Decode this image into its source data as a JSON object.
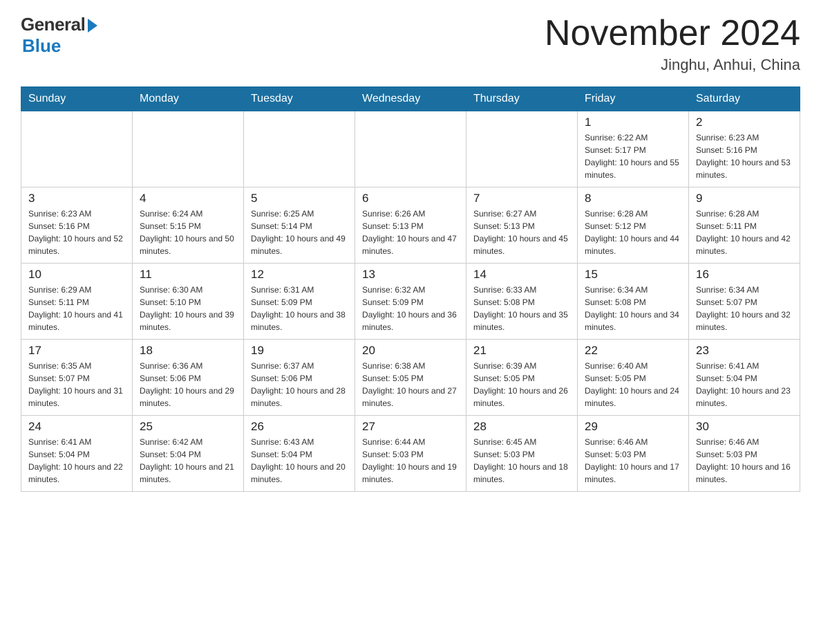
{
  "header": {
    "logo_general": "General",
    "logo_blue": "Blue",
    "month_title": "November 2024",
    "location": "Jinghu, Anhui, China"
  },
  "weekdays": [
    "Sunday",
    "Monday",
    "Tuesday",
    "Wednesday",
    "Thursday",
    "Friday",
    "Saturday"
  ],
  "weeks": [
    [
      {
        "day": "",
        "info": ""
      },
      {
        "day": "",
        "info": ""
      },
      {
        "day": "",
        "info": ""
      },
      {
        "day": "",
        "info": ""
      },
      {
        "day": "",
        "info": ""
      },
      {
        "day": "1",
        "info": "Sunrise: 6:22 AM\nSunset: 5:17 PM\nDaylight: 10 hours and 55 minutes."
      },
      {
        "day": "2",
        "info": "Sunrise: 6:23 AM\nSunset: 5:16 PM\nDaylight: 10 hours and 53 minutes."
      }
    ],
    [
      {
        "day": "3",
        "info": "Sunrise: 6:23 AM\nSunset: 5:16 PM\nDaylight: 10 hours and 52 minutes."
      },
      {
        "day": "4",
        "info": "Sunrise: 6:24 AM\nSunset: 5:15 PM\nDaylight: 10 hours and 50 minutes."
      },
      {
        "day": "5",
        "info": "Sunrise: 6:25 AM\nSunset: 5:14 PM\nDaylight: 10 hours and 49 minutes."
      },
      {
        "day": "6",
        "info": "Sunrise: 6:26 AM\nSunset: 5:13 PM\nDaylight: 10 hours and 47 minutes."
      },
      {
        "day": "7",
        "info": "Sunrise: 6:27 AM\nSunset: 5:13 PM\nDaylight: 10 hours and 45 minutes."
      },
      {
        "day": "8",
        "info": "Sunrise: 6:28 AM\nSunset: 5:12 PM\nDaylight: 10 hours and 44 minutes."
      },
      {
        "day": "9",
        "info": "Sunrise: 6:28 AM\nSunset: 5:11 PM\nDaylight: 10 hours and 42 minutes."
      }
    ],
    [
      {
        "day": "10",
        "info": "Sunrise: 6:29 AM\nSunset: 5:11 PM\nDaylight: 10 hours and 41 minutes."
      },
      {
        "day": "11",
        "info": "Sunrise: 6:30 AM\nSunset: 5:10 PM\nDaylight: 10 hours and 39 minutes."
      },
      {
        "day": "12",
        "info": "Sunrise: 6:31 AM\nSunset: 5:09 PM\nDaylight: 10 hours and 38 minutes."
      },
      {
        "day": "13",
        "info": "Sunrise: 6:32 AM\nSunset: 5:09 PM\nDaylight: 10 hours and 36 minutes."
      },
      {
        "day": "14",
        "info": "Sunrise: 6:33 AM\nSunset: 5:08 PM\nDaylight: 10 hours and 35 minutes."
      },
      {
        "day": "15",
        "info": "Sunrise: 6:34 AM\nSunset: 5:08 PM\nDaylight: 10 hours and 34 minutes."
      },
      {
        "day": "16",
        "info": "Sunrise: 6:34 AM\nSunset: 5:07 PM\nDaylight: 10 hours and 32 minutes."
      }
    ],
    [
      {
        "day": "17",
        "info": "Sunrise: 6:35 AM\nSunset: 5:07 PM\nDaylight: 10 hours and 31 minutes."
      },
      {
        "day": "18",
        "info": "Sunrise: 6:36 AM\nSunset: 5:06 PM\nDaylight: 10 hours and 29 minutes."
      },
      {
        "day": "19",
        "info": "Sunrise: 6:37 AM\nSunset: 5:06 PM\nDaylight: 10 hours and 28 minutes."
      },
      {
        "day": "20",
        "info": "Sunrise: 6:38 AM\nSunset: 5:05 PM\nDaylight: 10 hours and 27 minutes."
      },
      {
        "day": "21",
        "info": "Sunrise: 6:39 AM\nSunset: 5:05 PM\nDaylight: 10 hours and 26 minutes."
      },
      {
        "day": "22",
        "info": "Sunrise: 6:40 AM\nSunset: 5:05 PM\nDaylight: 10 hours and 24 minutes."
      },
      {
        "day": "23",
        "info": "Sunrise: 6:41 AM\nSunset: 5:04 PM\nDaylight: 10 hours and 23 minutes."
      }
    ],
    [
      {
        "day": "24",
        "info": "Sunrise: 6:41 AM\nSunset: 5:04 PM\nDaylight: 10 hours and 22 minutes."
      },
      {
        "day": "25",
        "info": "Sunrise: 6:42 AM\nSunset: 5:04 PM\nDaylight: 10 hours and 21 minutes."
      },
      {
        "day": "26",
        "info": "Sunrise: 6:43 AM\nSunset: 5:04 PM\nDaylight: 10 hours and 20 minutes."
      },
      {
        "day": "27",
        "info": "Sunrise: 6:44 AM\nSunset: 5:03 PM\nDaylight: 10 hours and 19 minutes."
      },
      {
        "day": "28",
        "info": "Sunrise: 6:45 AM\nSunset: 5:03 PM\nDaylight: 10 hours and 18 minutes."
      },
      {
        "day": "29",
        "info": "Sunrise: 6:46 AM\nSunset: 5:03 PM\nDaylight: 10 hours and 17 minutes."
      },
      {
        "day": "30",
        "info": "Sunrise: 6:46 AM\nSunset: 5:03 PM\nDaylight: 10 hours and 16 minutes."
      }
    ]
  ]
}
